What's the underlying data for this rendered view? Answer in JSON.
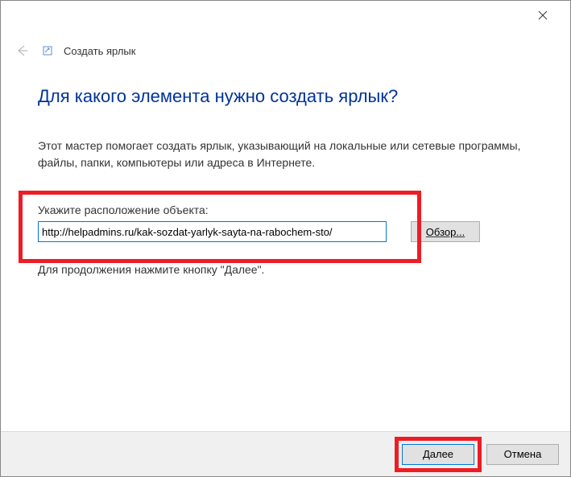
{
  "titlebar": {
    "close_aria": "Close"
  },
  "header": {
    "wizard_name": "Создать ярлык"
  },
  "main": {
    "heading": "Для какого элемента нужно создать ярлык?",
    "description": "Этот мастер помогает создать ярлык, указывающий на локальные или сетевые программы, файлы, папки, компьютеры или адреса в Интернете.",
    "input_label": "Укажите расположение объекта:",
    "input_value": "http://helpadmins.ru/kak-sozdat-yarlyk-sayta-na-rabochem-sto/",
    "browse_prefix": "О",
    "browse_rest": "бзор...",
    "hint": "Для продолжения нажмите кнопку \"Далее\"."
  },
  "footer": {
    "next_prefix": "Д",
    "next_rest": "алее",
    "cancel": "Отмена"
  }
}
